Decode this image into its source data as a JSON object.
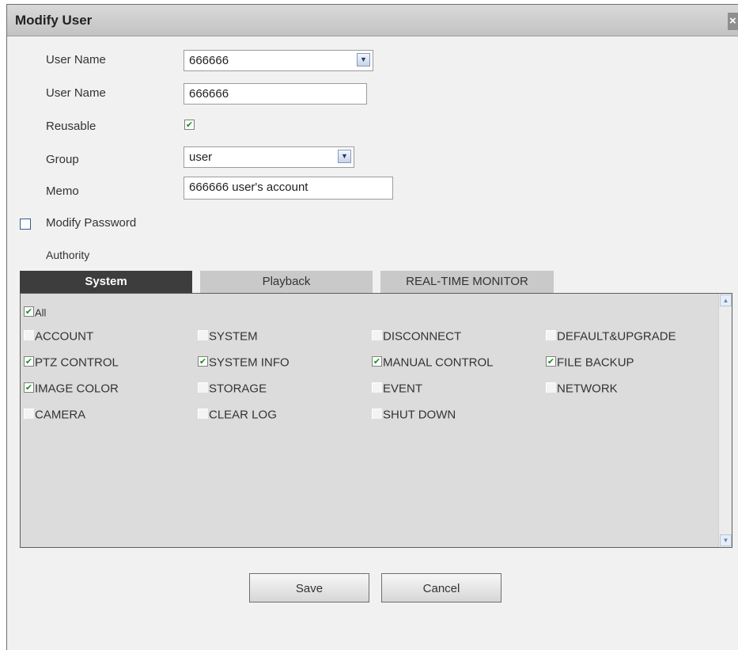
{
  "dialog": {
    "title": "Modify User",
    "close_glyph": "×"
  },
  "form": {
    "user_name_select_label": "User Name",
    "user_name_select_value": "666666",
    "user_name_label": "User Name",
    "user_name_value": "666666",
    "reusable_label": "Reusable",
    "reusable_checked": true,
    "group_label": "Group",
    "group_value": "user",
    "memo_label": "Memo",
    "memo_value": "666666 user's account",
    "modify_password_label": "Modify Password",
    "modify_password_checked": false,
    "authority_label": "Authority"
  },
  "tabs": [
    {
      "label": "System",
      "active": true
    },
    {
      "label": "Playback",
      "active": false
    },
    {
      "label": "REAL-TIME MONITOR",
      "active": false
    }
  ],
  "permissions": {
    "all": {
      "label": "All",
      "checked": true
    },
    "items": [
      {
        "label": "ACCOUNT",
        "checked": false
      },
      {
        "label": "SYSTEM",
        "checked": false
      },
      {
        "label": "DISCONNECT",
        "checked": false
      },
      {
        "label": "DEFAULT&UPGRADE",
        "checked": false
      },
      {
        "label": "PTZ CONTROL",
        "checked": true
      },
      {
        "label": "SYSTEM INFO",
        "checked": true
      },
      {
        "label": "MANUAL CONTROL",
        "checked": true
      },
      {
        "label": "FILE BACKUP",
        "checked": true
      },
      {
        "label": "IMAGE COLOR",
        "checked": true
      },
      {
        "label": "STORAGE",
        "checked": false
      },
      {
        "label": "EVENT",
        "checked": false
      },
      {
        "label": "NETWORK",
        "checked": false
      },
      {
        "label": "CAMERA",
        "checked": false
      },
      {
        "label": "CLEAR LOG",
        "checked": false
      },
      {
        "label": "SHUT DOWN",
        "checked": false
      }
    ]
  },
  "buttons": {
    "save_label": "Save",
    "cancel_label": "Cancel"
  },
  "icons": {
    "check": "✔",
    "dropdown": "▼",
    "scroll_up": "▲",
    "scroll_down": "▼"
  },
  "colors": {
    "active_tab": "#3d3d3d",
    "check_mark": "#1a8f1a"
  }
}
